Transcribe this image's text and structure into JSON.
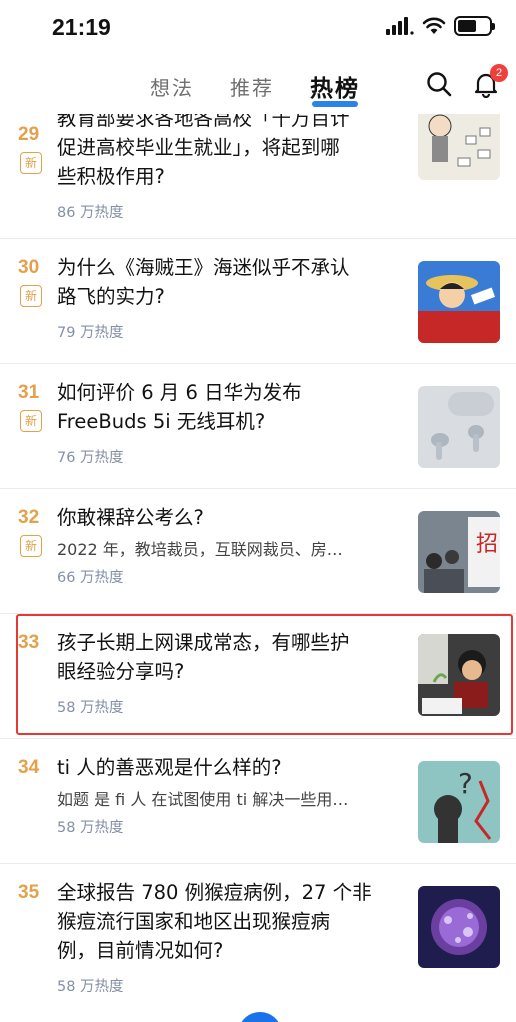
{
  "status_bar": {
    "time": "21:19"
  },
  "top_nav": {
    "tabs": [
      {
        "label": "想法"
      },
      {
        "label": "推荐"
      },
      {
        "label": "热榜"
      }
    ],
    "active_tab": "热榜",
    "notification_count": "2",
    "accent_color": "#056de8"
  },
  "feed": {
    "new_badge_label": "新",
    "items": [
      {
        "rank": "29",
        "title_lines": [
          "教育部要求各地各高校「千万百计",
          "促进高校毕业生就业」，将起到哪",
          "些积极作用?"
        ],
        "excerpt": "",
        "heat": "86 万热度",
        "is_new": true,
        "thumb": "cartoon-illustration"
      },
      {
        "rank": "30",
        "title_lines": [
          "为什么《海贼王》海迷似乎不承认",
          "路飞的实力?"
        ],
        "excerpt": "",
        "heat": "79 万热度",
        "is_new": true,
        "thumb": "anime-character"
      },
      {
        "rank": "31",
        "title_lines": [
          "如何评价 6 月 6 日华为发布",
          "FreeBuds 5i 无线耳机?"
        ],
        "excerpt": "",
        "heat": "76 万热度",
        "is_new": true,
        "thumb": "earbuds-photo"
      },
      {
        "rank": "32",
        "title_lines": [
          "你敢裸辞公考么?"
        ],
        "excerpt": "2022 年，教培裁员，互联网裁员、房…",
        "heat": "66 万热度",
        "is_new": true,
        "thumb": "job-fair-photo"
      },
      {
        "rank": "33",
        "title_lines": [
          "孩子长期上网课成常态，有哪些护",
          "眼经验分享吗?"
        ],
        "excerpt": "",
        "heat": "58 万热度",
        "is_new": false,
        "thumb": "child-studying-photo"
      },
      {
        "rank": "34",
        "title_lines": [
          "ti 人的善恶观是什么样的?"
        ],
        "excerpt": "如题 是 fi 人 在试图使用 ti 解决一些用…",
        "heat": "58 万热度",
        "is_new": false,
        "thumb": "question-mark-illustration"
      },
      {
        "rank": "35",
        "title_lines": [
          "全球报告 780 例猴痘病例，27 个非",
          "猴痘流行国家和地区出现猴痘病",
          "例，目前情况如何?"
        ],
        "excerpt": "",
        "heat": "58 万热度",
        "is_new": false,
        "thumb": "virus-illustration"
      }
    ],
    "rank_color": "#e2a14a",
    "highlight_color": "#e53935"
  }
}
